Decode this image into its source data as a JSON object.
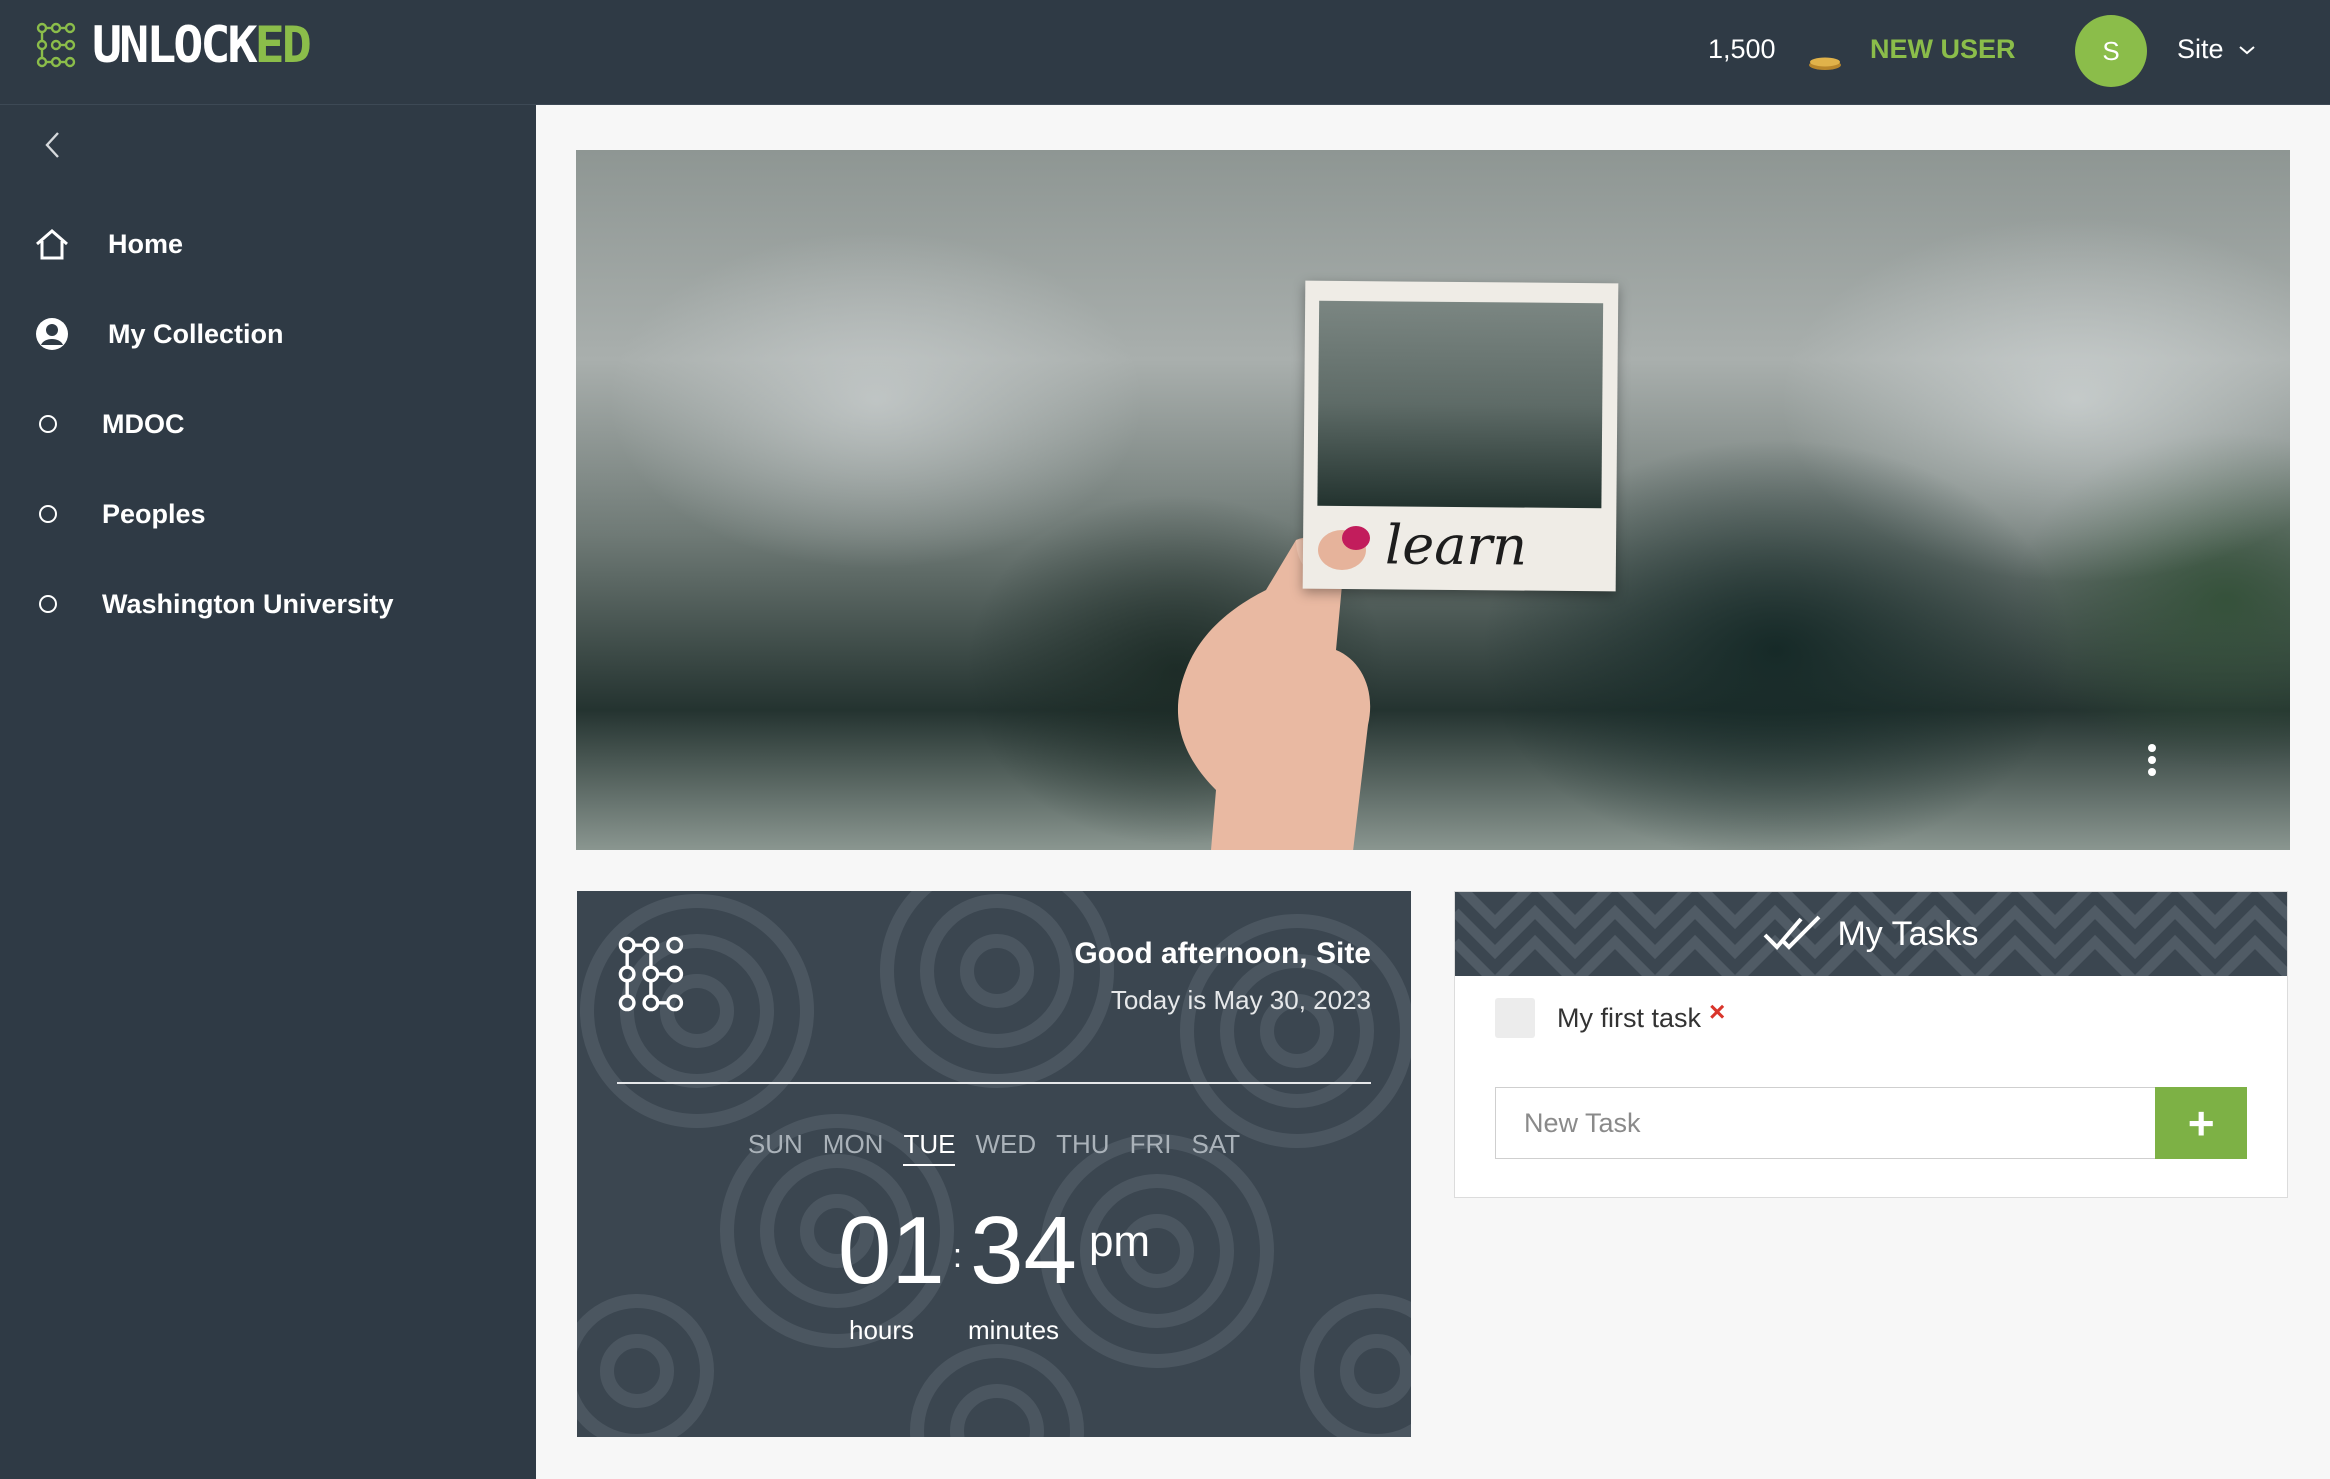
{
  "brand": {
    "name_part1": "UNLOCK",
    "name_part2": "ED"
  },
  "header": {
    "coins": "1,500",
    "role_badge": "NEW USER",
    "avatar_initial": "S",
    "user_menu_label": "Site"
  },
  "sidebar": {
    "items": [
      {
        "label": "Home",
        "icon": "home-icon"
      },
      {
        "label": "My Collection",
        "icon": "user-circle-icon"
      },
      {
        "label": "MDOC",
        "icon": "circle-icon"
      },
      {
        "label": "Peoples",
        "icon": "circle-icon"
      },
      {
        "label": "Washington University",
        "icon": "circle-icon"
      }
    ]
  },
  "banner": {
    "photo_word": "learn"
  },
  "clock_widget": {
    "greeting": "Good afternoon, Site",
    "date_text": "Today is May 30, 2023",
    "days": [
      "SUN",
      "MON",
      "TUE",
      "WED",
      "THU",
      "FRI",
      "SAT"
    ],
    "active_day": "TUE",
    "hours": "01",
    "minutes": "34",
    "separator": ":",
    "ampm": "pm",
    "hours_label": "hours",
    "minutes_label": "minutes"
  },
  "tasks_widget": {
    "title": "My Tasks",
    "tasks": [
      {
        "label": "My first task",
        "done": false
      }
    ],
    "remove_symbol": "×",
    "new_task_placeholder": "New Task",
    "add_symbol": "+"
  },
  "colors": {
    "sidebar_bg": "#2f3a45",
    "accent_green": "#8bbd4a",
    "widget_bg": "#3b4650",
    "remove_red": "#d9352b"
  }
}
